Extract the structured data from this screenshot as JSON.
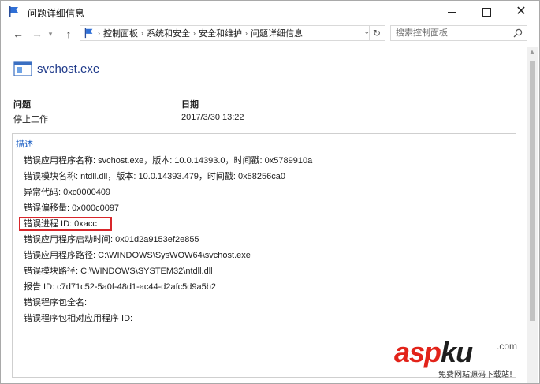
{
  "window": {
    "title": "问题详细信息"
  },
  "navigation": {
    "breadcrumbs": [
      "控制面板",
      "系统和安全",
      "安全和维护",
      "问题详细信息"
    ],
    "search_placeholder": "搜索控制面板"
  },
  "report": {
    "app_name": "svchost.exe",
    "problem_label": "问题",
    "problem_value": "停止工作",
    "date_label": "日期",
    "date_value": "2017/3/30 13:22",
    "description_label": "描述",
    "details": [
      "错误应用程序名称: svchost.exe，版本: 10.0.14393.0，时间戳: 0x5789910a",
      "错误模块名称: ntdll.dll，版本: 10.0.14393.479，时间戳: 0x58256ca0",
      "异常代码: 0xc0000409",
      "错误偏移量: 0x000c0097",
      "错误进程 ID: 0xacc",
      "错误应用程序启动时间: 0x01d2a9153ef2e855",
      "错误应用程序路径: C:\\WINDOWS\\SysWOW64\\svchost.exe",
      "错误模块路径: C:\\WINDOWS\\SYSTEM32\\ntdll.dll",
      "报告 ID: c7d71c52-5a0f-48d1-ac44-d2afc5d9a5b2",
      "错误程序包全名:",
      "错误程序包相对应用程序 ID:"
    ],
    "highlight_color": "#d8262a"
  },
  "watermark": {
    "brand_red": "asp",
    "brand_dark": "ku",
    "domain": ".com",
    "tagline": "免费网站源码下载站!"
  },
  "colors": {
    "accent_blue": "#1f62c6",
    "app_name_blue": "#1f3a8a"
  }
}
